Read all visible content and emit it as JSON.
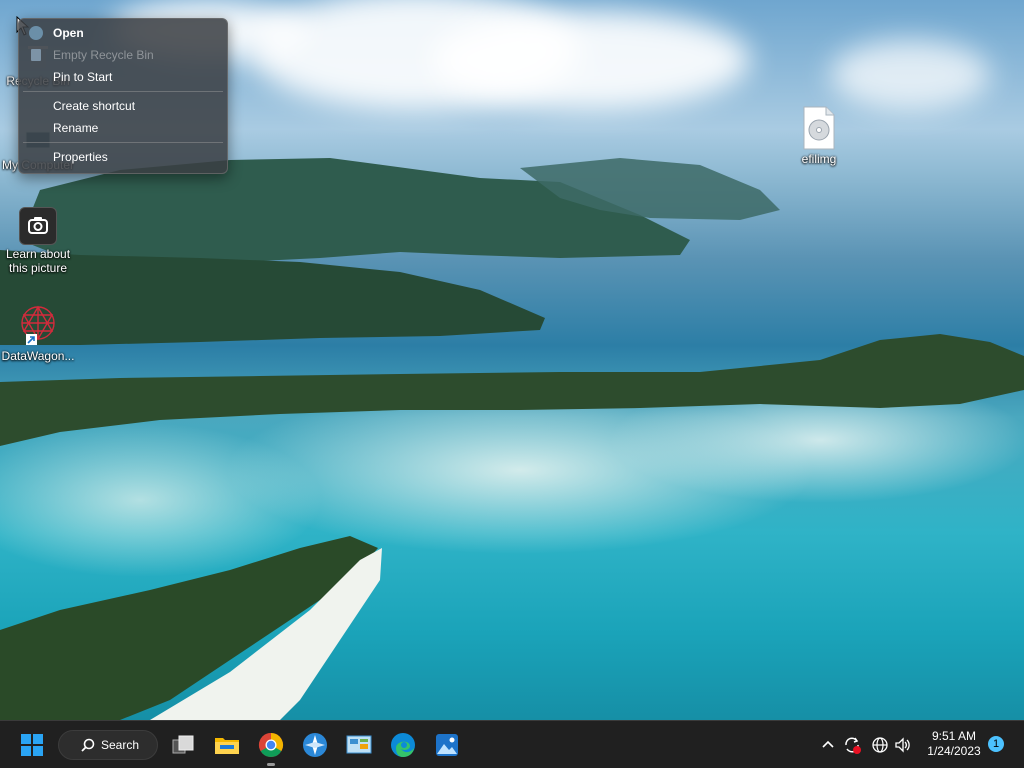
{
  "desktop": {
    "icons": [
      {
        "label": "Recycle Bin"
      },
      {
        "label": "My Computer"
      },
      {
        "label": "Learn about this picture"
      },
      {
        "label": "DataWagon..."
      },
      {
        "label": "efilimg"
      }
    ]
  },
  "context_menu": {
    "items": [
      {
        "label": "Open",
        "state": "default"
      },
      {
        "label": "Empty Recycle Bin",
        "state": "disabled"
      },
      {
        "label": "Pin to Start",
        "state": "normal"
      },
      {
        "label": "Create shortcut",
        "state": "normal"
      },
      {
        "label": "Rename",
        "state": "normal"
      },
      {
        "label": "Properties",
        "state": "normal"
      }
    ]
  },
  "taskbar": {
    "search_label": "Search",
    "apps": [
      {
        "icon": "start-windows-icon"
      },
      {
        "icon": "task-view-icon"
      },
      {
        "icon": "file-explorer-icon"
      },
      {
        "icon": "chrome-icon"
      },
      {
        "icon": "app-compass-icon"
      },
      {
        "icon": "control-panel-icon"
      },
      {
        "icon": "edge-icon"
      },
      {
        "icon": "photos-icon"
      }
    ],
    "tray": {
      "time": "9:51 AM",
      "date": "1/24/2023",
      "notification_count": "1"
    }
  },
  "colors": {
    "accent": "#0078d4",
    "taskbar": "#202020",
    "menu_bg": "#3a3e42",
    "sync_alert": "#e81123"
  }
}
